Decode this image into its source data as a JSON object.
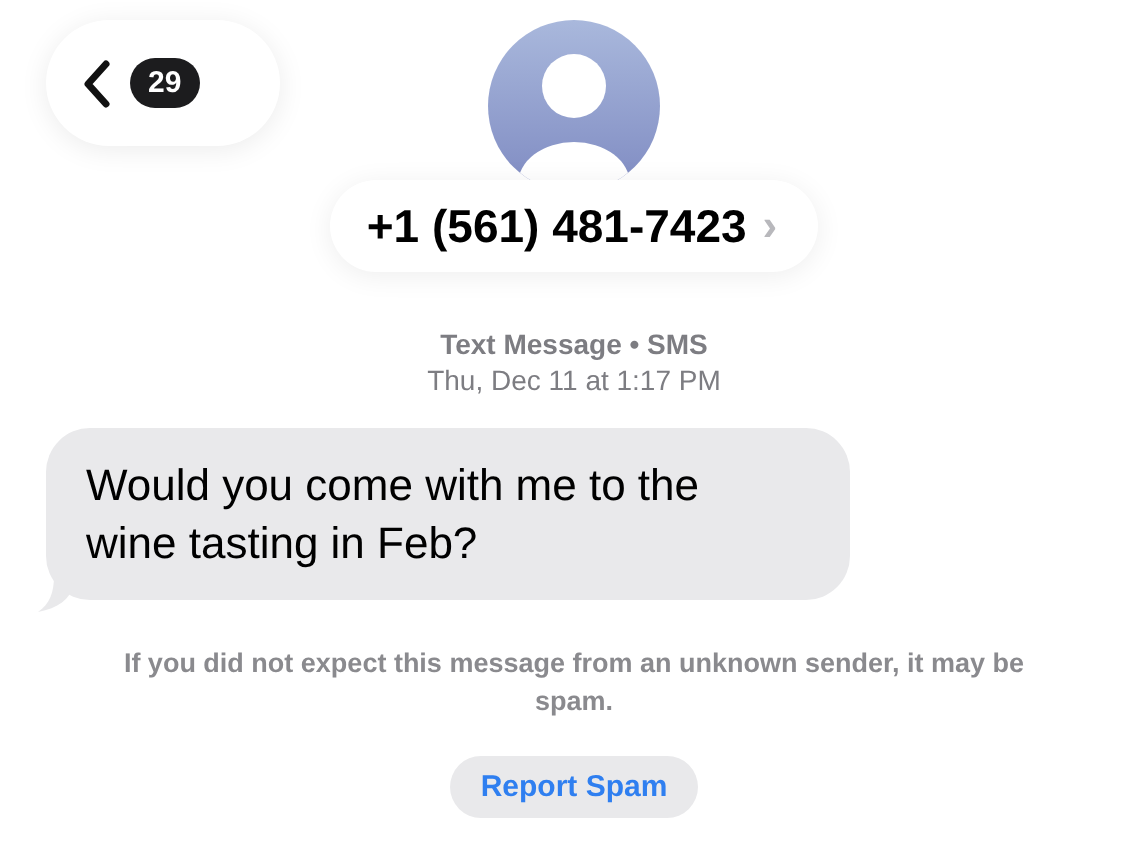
{
  "header": {
    "back_count": "29",
    "contact": "+1 (561) 481-7423",
    "chevron": "›"
  },
  "conversation": {
    "service": "Text Message • SMS",
    "timestamp": "Thu, Dec 11 at 1:17 PM",
    "messages": [
      {
        "text": "Would you come with me to the wine tasting in Feb?",
        "kind": "incoming"
      }
    ],
    "warning": "If you did not expect this message from an unknown sender, it may be spam.",
    "report_button": "Report Spam"
  }
}
